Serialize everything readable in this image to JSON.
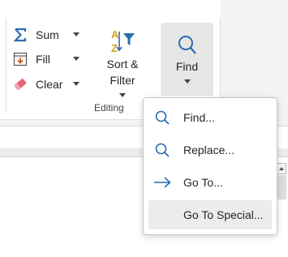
{
  "editing": {
    "sum_label": "Sum",
    "fill_label": "Fill",
    "clear_label": "Clear",
    "sort_label_line1": "Sort &",
    "sort_label_line2": "Filter",
    "find_label": "Find",
    "group_label": "Editing"
  },
  "find_menu": {
    "items": [
      {
        "label": "Find...",
        "icon": "search-icon"
      },
      {
        "label": "Replace...",
        "icon": "search-icon"
      },
      {
        "label": "Go To...",
        "icon": "arrow-right-icon"
      },
      {
        "label": "Go To Special...",
        "icon": "none"
      }
    ]
  },
  "colors": {
    "accent_blue": "#2b6cb0",
    "fill_orange": "#d9541e",
    "eraser_pink": "#e8637a",
    "hover_gray": "#e6e6e6"
  }
}
